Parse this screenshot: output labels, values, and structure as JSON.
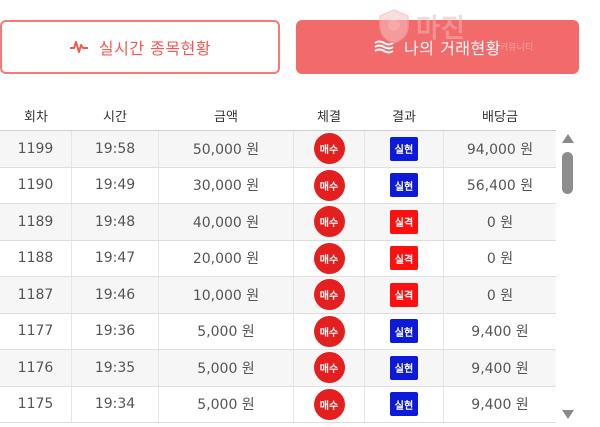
{
  "tabs": {
    "live": {
      "label": "실시간 종목현황",
      "icon": "pulse-icon"
    },
    "mine": {
      "label": "나의 거래현황",
      "icon": "waves-icon"
    }
  },
  "watermark": {
    "text": "마진",
    "sub": "커뮤니티"
  },
  "table": {
    "headers": [
      "회차",
      "시간",
      "금액",
      "체결",
      "결과",
      "배당금"
    ],
    "rows": [
      {
        "round": "1199",
        "time": "19:58",
        "amount": "50,000 원",
        "trade": "매수",
        "result": "실현",
        "payout": "94,000 원"
      },
      {
        "round": "1190",
        "time": "19:49",
        "amount": "30,000 원",
        "trade": "매수",
        "result": "실현",
        "payout": "56,400 원"
      },
      {
        "round": "1189",
        "time": "19:48",
        "amount": "40,000 원",
        "trade": "매수",
        "result": "실격",
        "payout": "0 원"
      },
      {
        "round": "1188",
        "time": "19:47",
        "amount": "20,000 원",
        "trade": "매수",
        "result": "실격",
        "payout": "0 원"
      },
      {
        "round": "1187",
        "time": "19:46",
        "amount": "10,000 원",
        "trade": "매수",
        "result": "실격",
        "payout": "0 원"
      },
      {
        "round": "1177",
        "time": "19:36",
        "amount": "5,000 원",
        "trade": "매수",
        "result": "실현",
        "payout": "9,400 원"
      },
      {
        "round": "1176",
        "time": "19:35",
        "amount": "5,000 원",
        "trade": "매수",
        "result": "실현",
        "payout": "9,400 원"
      },
      {
        "round": "1175",
        "time": "19:34",
        "amount": "5,000 원",
        "trade": "매수",
        "result": "실현",
        "payout": "9,400 원"
      }
    ]
  },
  "colors": {
    "accent": "#f26a6a",
    "buy_badge": "#e3201f",
    "result_win": "#0d1bd8",
    "result_lose": "#ff1010"
  }
}
